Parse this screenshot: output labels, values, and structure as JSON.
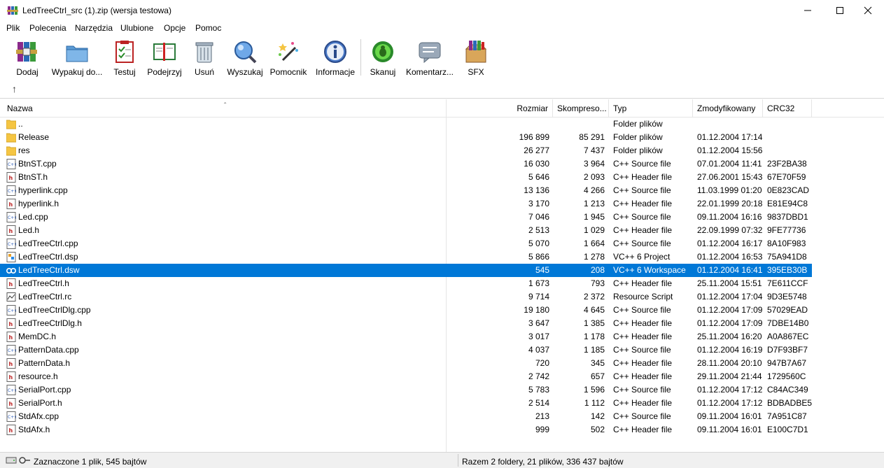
{
  "window": {
    "title": "LedTreeCtrl_src (1).zip (wersja testowa)"
  },
  "menu": [
    "Plik",
    "Polecenia",
    "Narzędzia",
    "Ulubione",
    "Opcje",
    "Pomoc"
  ],
  "toolbar": [
    {
      "label": "Dodaj",
      "icon": "books-add-icon"
    },
    {
      "label": "Wypakuj do...",
      "icon": "folder-extract-icon"
    },
    {
      "label": "Testuj",
      "icon": "clipboard-test-icon"
    },
    {
      "label": "Podejrzyj",
      "icon": "book-view-icon"
    },
    {
      "label": "Usuń",
      "icon": "trash-icon"
    },
    {
      "label": "Wyszukaj",
      "icon": "magnifier-icon"
    },
    {
      "label": "Pomocnik",
      "icon": "wizard-wand-icon"
    },
    {
      "label": "Informacje",
      "icon": "info-icon"
    },
    {
      "label": "Skanuj",
      "icon": "virus-scan-icon"
    },
    {
      "label": "Komentarz...",
      "icon": "comment-icon"
    },
    {
      "label": "SFX",
      "icon": "sfx-box-icon"
    }
  ],
  "columns": {
    "name": "Nazwa",
    "size": "Rozmiar",
    "packed": "Skompreso...",
    "type": "Typ",
    "modified": "Zmodyfikowany",
    "crc": "CRC32"
  },
  "files": [
    {
      "name": "..",
      "size": "",
      "packed": "",
      "type": "Folder plików",
      "modified": "",
      "crc": "",
      "kind": "folder"
    },
    {
      "name": "Release",
      "size": "196 899",
      "packed": "85 291",
      "type": "Folder plików",
      "modified": "01.12.2004 17:14",
      "crc": "",
      "kind": "folder"
    },
    {
      "name": "res",
      "size": "26 277",
      "packed": "7 437",
      "type": "Folder plików",
      "modified": "01.12.2004 15:56",
      "crc": "",
      "kind": "folder"
    },
    {
      "name": "BtnST.cpp",
      "size": "16 030",
      "packed": "3 964",
      "type": "C++ Source file",
      "modified": "07.01.2004 11:41",
      "crc": "23F2BA38",
      "kind": "cpp"
    },
    {
      "name": "BtnST.h",
      "size": "5 646",
      "packed": "2 093",
      "type": "C++ Header file",
      "modified": "27.06.2001 15:43",
      "crc": "67E70F59",
      "kind": "h"
    },
    {
      "name": "hyperlink.cpp",
      "size": "13 136",
      "packed": "4 266",
      "type": "C++ Source file",
      "modified": "11.03.1999 01:20",
      "crc": "0E823CAD",
      "kind": "cpp"
    },
    {
      "name": "hyperlink.h",
      "size": "3 170",
      "packed": "1 213",
      "type": "C++ Header file",
      "modified": "22.01.1999 20:18",
      "crc": "E81E94C8",
      "kind": "h"
    },
    {
      "name": "Led.cpp",
      "size": "7 046",
      "packed": "1 945",
      "type": "C++ Source file",
      "modified": "09.11.2004 16:16",
      "crc": "9837DBD1",
      "kind": "cpp"
    },
    {
      "name": "Led.h",
      "size": "2 513",
      "packed": "1 029",
      "type": "C++ Header file",
      "modified": "22.09.1999 07:32",
      "crc": "9FE77736",
      "kind": "h"
    },
    {
      "name": "LedTreeCtrl.cpp",
      "size": "5 070",
      "packed": "1 664",
      "type": "C++ Source file",
      "modified": "01.12.2004 16:17",
      "crc": "8A10F983",
      "kind": "cpp"
    },
    {
      "name": "LedTreeCtrl.dsp",
      "size": "5 866",
      "packed": "1 278",
      "type": "VC++ 6 Project",
      "modified": "01.12.2004 16:53",
      "crc": "75A941D8",
      "kind": "dsp"
    },
    {
      "name": "LedTreeCtrl.dsw",
      "size": "545",
      "packed": "208",
      "type": "VC++ 6 Workspace",
      "modified": "01.12.2004 16:41",
      "crc": "395EB30B",
      "kind": "dsw",
      "selected": true
    },
    {
      "name": "LedTreeCtrl.h",
      "size": "1 673",
      "packed": "793",
      "type": "C++ Header file",
      "modified": "25.11.2004 15:51",
      "crc": "7E611CCF",
      "kind": "h"
    },
    {
      "name": "LedTreeCtrl.rc",
      "size": "9 714",
      "packed": "2 372",
      "type": "Resource Script",
      "modified": "01.12.2004 17:04",
      "crc": "9D3E5748",
      "kind": "rc"
    },
    {
      "name": "LedTreeCtrlDlg.cpp",
      "size": "19 180",
      "packed": "4 645",
      "type": "C++ Source file",
      "modified": "01.12.2004 17:09",
      "crc": "57029EAD",
      "kind": "cpp"
    },
    {
      "name": "LedTreeCtrlDlg.h",
      "size": "3 647",
      "packed": "1 385",
      "type": "C++ Header file",
      "modified": "01.12.2004 17:09",
      "crc": "7DBE14B0",
      "kind": "h"
    },
    {
      "name": "MemDC.h",
      "size": "3 017",
      "packed": "1 178",
      "type": "C++ Header file",
      "modified": "25.11.2004 16:20",
      "crc": "A0A867EC",
      "kind": "h"
    },
    {
      "name": "PatternData.cpp",
      "size": "4 037",
      "packed": "1 185",
      "type": "C++ Source file",
      "modified": "01.12.2004 16:19",
      "crc": "D7F93BF7",
      "kind": "cpp"
    },
    {
      "name": "PatternData.h",
      "size": "720",
      "packed": "345",
      "type": "C++ Header file",
      "modified": "28.11.2004 20:10",
      "crc": "947B7A67",
      "kind": "h"
    },
    {
      "name": "resource.h",
      "size": "2 742",
      "packed": "657",
      "type": "C++ Header file",
      "modified": "29.11.2004 21:44",
      "crc": "1729560C",
      "kind": "h"
    },
    {
      "name": "SerialPort.cpp",
      "size": "5 783",
      "packed": "1 596",
      "type": "C++ Source file",
      "modified": "01.12.2004 17:12",
      "crc": "C84AC349",
      "kind": "cpp"
    },
    {
      "name": "SerialPort.h",
      "size": "2 514",
      "packed": "1 112",
      "type": "C++ Header file",
      "modified": "01.12.2004 17:12",
      "crc": "BDBADBE5",
      "kind": "h"
    },
    {
      "name": "StdAfx.cpp",
      "size": "213",
      "packed": "142",
      "type": "C++ Source file",
      "modified": "09.11.2004 16:01",
      "crc": "7A951C87",
      "kind": "cpp"
    },
    {
      "name": "StdAfx.h",
      "size": "999",
      "packed": "502",
      "type": "C++ Header file",
      "modified": "09.11.2004 16:01",
      "crc": "E100C7D1",
      "kind": "h"
    }
  ],
  "status": {
    "left": "Zaznaczone 1 plik, 545 bajtów",
    "right": "Razem 2 foldery, 21 plików, 336 437 bajtów"
  },
  "colors": {
    "selection": "#0078d7",
    "folder": "#f5c542"
  }
}
